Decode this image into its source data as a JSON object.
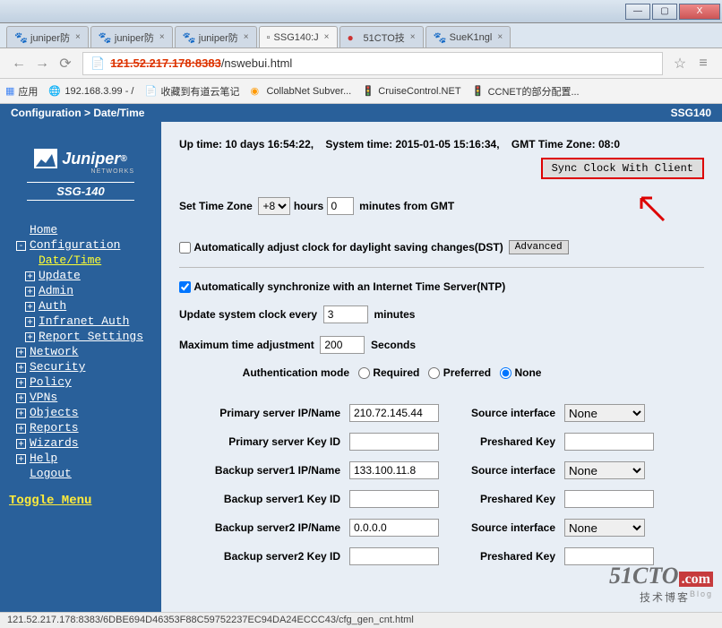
{
  "window": {
    "min": "—",
    "max": "▢",
    "close": "X"
  },
  "tabs": [
    {
      "label": "juniper防"
    },
    {
      "label": "juniper防"
    },
    {
      "label": "juniper防"
    },
    {
      "label": "SSG140:J",
      "active": true,
      "icon": "blank"
    },
    {
      "label": "51CTO技"
    },
    {
      "label": "SueK1ngl"
    }
  ],
  "address": {
    "redacted": "121.52.217.178:8383",
    "path": "/nswebui.html",
    "file_icon": "📄"
  },
  "bookmarks": {
    "apps": "应用",
    "items": [
      {
        "label": "192.168.3.99 - /"
      },
      {
        "label": "收藏到有道云笔记"
      },
      {
        "label": "CollabNet Subver..."
      },
      {
        "label": "CruiseControl.NET"
      },
      {
        "label": "CCNET的部分配置..."
      }
    ]
  },
  "breadcrumb": {
    "path": "Configuration > Date/Time",
    "right": "SSG140"
  },
  "logo": {
    "brand": "Juniper",
    "networks": "NETWORKS",
    "model": "SSG-140",
    "reg": "®"
  },
  "tree": [
    {
      "label": "Home",
      "level": 1,
      "box": ""
    },
    {
      "label": "Configuration",
      "level": 1,
      "box": "-"
    },
    {
      "label": "Date/Time",
      "level": 2,
      "box": "",
      "selected": true
    },
    {
      "label": "Update",
      "level": 2,
      "box": "+"
    },
    {
      "label": "Admin",
      "level": 2,
      "box": "+"
    },
    {
      "label": "Auth",
      "level": 2,
      "box": "+"
    },
    {
      "label": "Infranet Auth",
      "level": 2,
      "box": "+"
    },
    {
      "label": "Report Settings",
      "level": 2,
      "box": "+"
    },
    {
      "label": "Network",
      "level": 1,
      "box": "+"
    },
    {
      "label": "Security",
      "level": 1,
      "box": "+"
    },
    {
      "label": "Policy",
      "level": 1,
      "box": "+"
    },
    {
      "label": "VPNs",
      "level": 1,
      "box": "+"
    },
    {
      "label": "Objects",
      "level": 1,
      "box": "+"
    },
    {
      "label": "Reports",
      "level": 1,
      "box": "+"
    },
    {
      "label": "Wizards",
      "level": 1,
      "box": "+"
    },
    {
      "label": "Help",
      "level": 1,
      "box": "+"
    },
    {
      "label": "Logout",
      "level": 1,
      "box": ""
    }
  ],
  "toggle_menu": "Toggle Menu",
  "main": {
    "uptime": "Up time: 10 days 16:54:22,",
    "systime": "System time: 2015-01-05 15:16:34,",
    "gmt": "GMT Time Zone: 08:0",
    "sync_btn": "Sync Clock With Client",
    "set_tz_label": "Set Time Zone",
    "tz_hours": "+8",
    "hours_label": "hours",
    "tz_minutes": "0",
    "minutes_label": "minutes  from GMT",
    "dst_label": "Automatically adjust clock for daylight saving changes(DST)",
    "advanced": "Advanced",
    "ntp_label": "Automatically synchronize with an Internet Time Server(NTP)",
    "update_label": "Update system clock every",
    "update_val": "3",
    "update_unit": "minutes",
    "maxadj_label": "Maximum time adjustment",
    "maxadj_val": "200",
    "maxadj_unit": "Seconds",
    "authmode_label": "Authentication mode",
    "auth_required": "Required",
    "auth_preferred": "Preferred",
    "auth_none": "None",
    "servers": {
      "primary_ip_label": "Primary server IP/Name",
      "primary_ip": "210.72.145.44",
      "primary_key_label": "Primary server Key ID",
      "primary_key": "",
      "backup1_ip_label": "Backup server1 IP/Name",
      "backup1_ip": "133.100.11.8",
      "backup1_key_label": "Backup server1 Key ID",
      "backup1_key": "",
      "backup2_ip_label": "Backup server2 IP/Name",
      "backup2_ip": "0.0.0.0",
      "backup2_key_label": "Backup server2 Key ID",
      "backup2_key": "",
      "src_if_label": "Source interface",
      "src_if_none": "None",
      "preshared_label": "Preshared Key"
    }
  },
  "status_bar": "121.52.217.178:8383/6DBE694D46353F88C59752237EC94DA24ECCC43/cfg_gen_cnt.html",
  "watermark": {
    "main1": "51CTO",
    "main2": ".com",
    "sub": "技术博客",
    "blog": "Blog"
  }
}
